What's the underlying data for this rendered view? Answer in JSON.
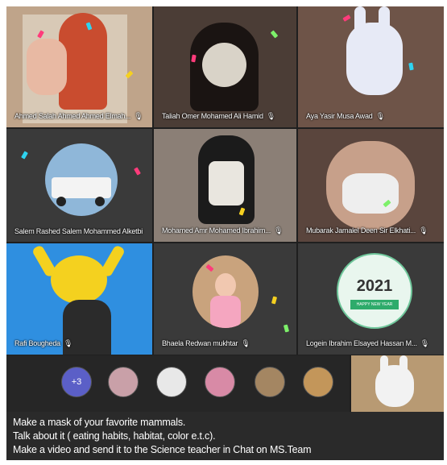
{
  "participants": [
    {
      "name": "Ahmed Salah Ahmed Ahmed Elmah..."
    },
    {
      "name": "Taliah Omer Mohamed Ali Hamid"
    },
    {
      "name": "Aya Yasir Musa Awad"
    },
    {
      "name": "Salem Rashed Salem Mohammed Alketbi"
    },
    {
      "name": "Mohamed Amr Mohamed Ibrahim..."
    },
    {
      "name": "Mubarak Jamalel Deen Sir Elkhati..."
    },
    {
      "name": "Rafi Bougheda"
    },
    {
      "name": "Bhaela Redwan mukhtar"
    },
    {
      "name": "Logein Ibrahim Elsayed Hassan M..."
    }
  ],
  "tile_2021": {
    "year": "2021",
    "banner": "HAPPY NEW YEAR"
  },
  "strip": {
    "overflow_count": "+3"
  },
  "caption": {
    "line1": "Make a mask of your favorite mammals.",
    "line2": "Talk about it   ( eating habits, habitat, color  e.t.c).",
    "line3": "Make a video and send it to the Science teacher in Chat on MS.Team"
  },
  "icons": {
    "mic": "mic-muted-icon"
  },
  "colors": {
    "accent": "#5b5fc7",
    "pikachu_bg": "#2f8fe0",
    "stage_bg": "#1f1f1f"
  }
}
